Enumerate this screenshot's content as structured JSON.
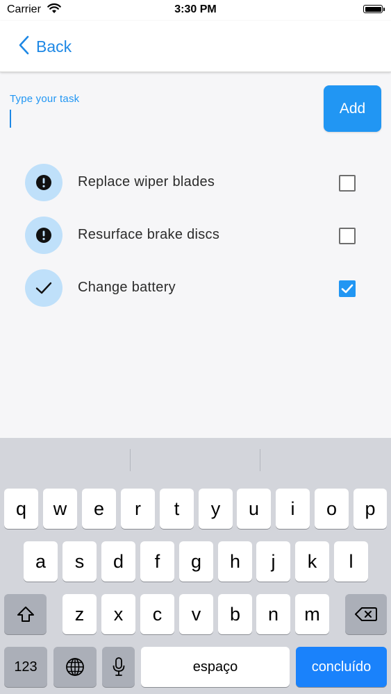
{
  "status_bar": {
    "carrier": "Carrier",
    "time": "3:30 PM"
  },
  "nav": {
    "back_label": "Back"
  },
  "task_input": {
    "label": "Type your task",
    "value": "",
    "add_label": "Add"
  },
  "tasks": [
    {
      "text": "Replace wiper blades",
      "done": false,
      "icon": "exclamation-icon"
    },
    {
      "text": "Resurface brake discs",
      "done": false,
      "icon": "exclamation-icon"
    },
    {
      "text": "Change battery",
      "done": true,
      "icon": "checkmark-icon"
    }
  ],
  "keyboard": {
    "row1": [
      "q",
      "w",
      "e",
      "r",
      "t",
      "y",
      "u",
      "i",
      "o",
      "p"
    ],
    "row2": [
      "a",
      "s",
      "d",
      "f",
      "g",
      "h",
      "j",
      "k",
      "l"
    ],
    "row3": [
      "z",
      "x",
      "c",
      "v",
      "b",
      "n",
      "m"
    ],
    "numbers_label": "123",
    "space_label": "espaço",
    "done_label": "concluído"
  },
  "colors": {
    "accent": "#2196f3",
    "icon_bg": "#bfe0fa",
    "keyboard_done": "#1a82fb"
  }
}
